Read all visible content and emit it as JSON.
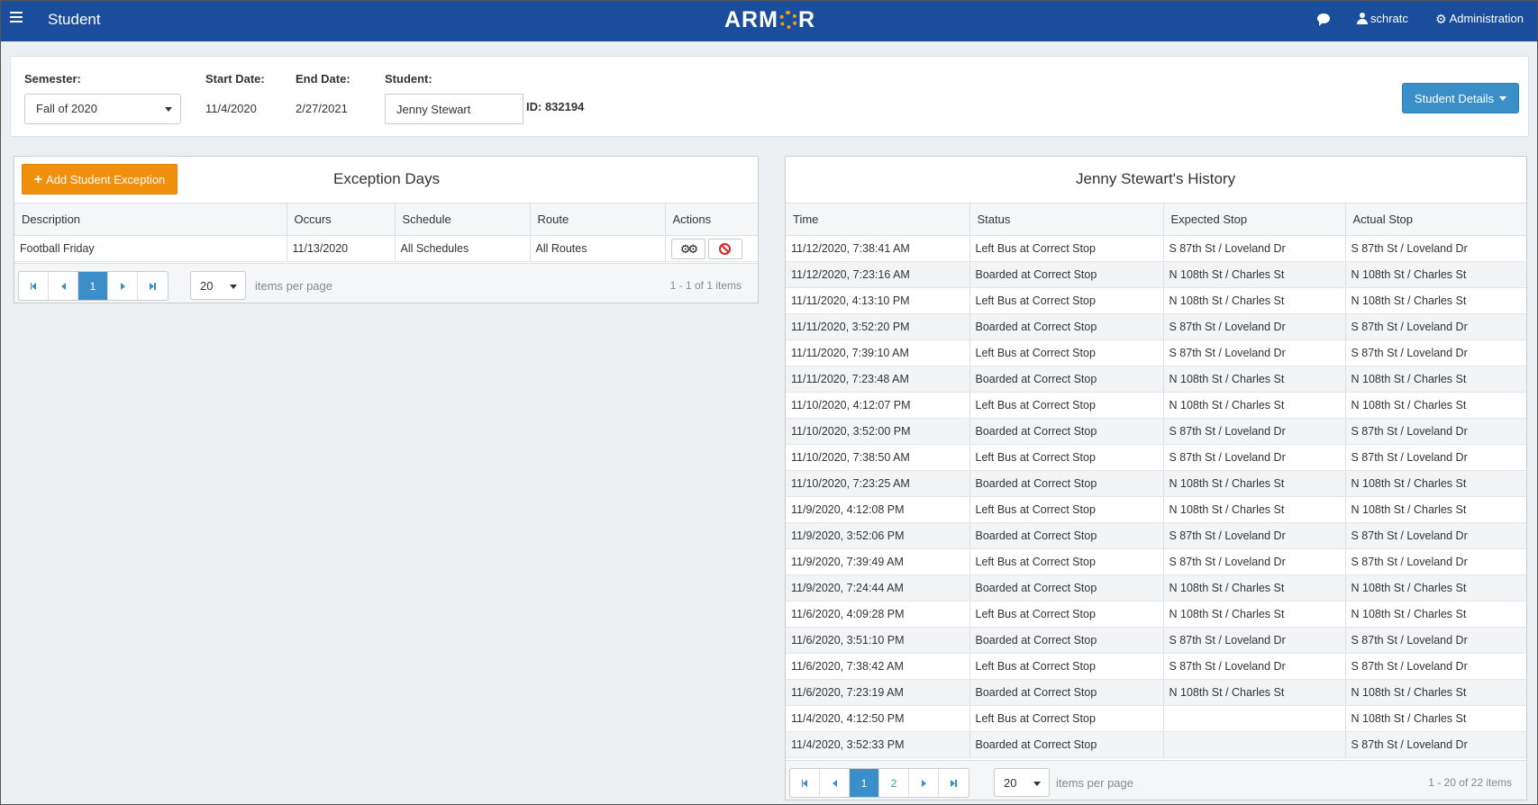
{
  "header": {
    "menu_icon": "hamburger-icon",
    "title": "Student",
    "logo_left": "ARM",
    "logo_right": "R",
    "user": "schratc",
    "admin": "Administration",
    "accent": "#1a4e9c"
  },
  "filters": {
    "semester_label": "Semester:",
    "semester_value": "Fall of 2020",
    "start_label": "Start Date:",
    "start_value": "11/4/2020",
    "end_label": "End Date:",
    "end_value": "2/27/2021",
    "student_label": "Student:",
    "student_value": "Jenny Stewart",
    "id_text": "ID: 832194",
    "details_button": "Student Details"
  },
  "exceptions": {
    "add_button": "Add Student Exception",
    "title": "Exception Days",
    "columns": [
      "Description",
      "Occurs",
      "Schedule",
      "Route",
      "Actions"
    ],
    "rows": [
      {
        "description": "Football Friday",
        "occurs": "11/13/2020",
        "schedule": "All Schedules",
        "route": "All Routes"
      }
    ],
    "page": "1",
    "page_size": "20",
    "per_page_label": "items per page",
    "count": "1 - 1 of 1 items"
  },
  "history": {
    "title": "Jenny Stewart's History",
    "columns": [
      "Time",
      "Status",
      "Expected Stop",
      "Actual Stop"
    ],
    "rows": [
      [
        "11/12/2020, 7:38:41 AM",
        "Left Bus at Correct Stop",
        "S 87th St / Loveland Dr",
        "S 87th St / Loveland Dr"
      ],
      [
        "11/12/2020, 7:23:16 AM",
        "Boarded at Correct Stop",
        "N 108th St / Charles St",
        "N 108th St / Charles St"
      ],
      [
        "11/11/2020, 4:13:10 PM",
        "Left Bus at Correct Stop",
        "N 108th St / Charles St",
        "N 108th St / Charles St"
      ],
      [
        "11/11/2020, 3:52:20 PM",
        "Boarded at Correct Stop",
        "S 87th St / Loveland Dr",
        "S 87th St / Loveland Dr"
      ],
      [
        "11/11/2020, 7:39:10 AM",
        "Left Bus at Correct Stop",
        "S 87th St / Loveland Dr",
        "S 87th St / Loveland Dr"
      ],
      [
        "11/11/2020, 7:23:48 AM",
        "Boarded at Correct Stop",
        "N 108th St / Charles St",
        "N 108th St / Charles St"
      ],
      [
        "11/10/2020, 4:12:07 PM",
        "Left Bus at Correct Stop",
        "N 108th St / Charles St",
        "N 108th St / Charles St"
      ],
      [
        "11/10/2020, 3:52:00 PM",
        "Boarded at Correct Stop",
        "S 87th St / Loveland Dr",
        "S 87th St / Loveland Dr"
      ],
      [
        "11/10/2020, 7:38:50 AM",
        "Left Bus at Correct Stop",
        "S 87th St / Loveland Dr",
        "S 87th St / Loveland Dr"
      ],
      [
        "11/10/2020, 7:23:25 AM",
        "Boarded at Correct Stop",
        "N 108th St / Charles St",
        "N 108th St / Charles St"
      ],
      [
        "11/9/2020, 4:12:08 PM",
        "Left Bus at Correct Stop",
        "N 108th St / Charles St",
        "N 108th St / Charles St"
      ],
      [
        "11/9/2020, 3:52:06 PM",
        "Boarded at Correct Stop",
        "S 87th St / Loveland Dr",
        "S 87th St / Loveland Dr"
      ],
      [
        "11/9/2020, 7:39:49 AM",
        "Left Bus at Correct Stop",
        "S 87th St / Loveland Dr",
        "S 87th St / Loveland Dr"
      ],
      [
        "11/9/2020, 7:24:44 AM",
        "Boarded at Correct Stop",
        "N 108th St / Charles St",
        "N 108th St / Charles St"
      ],
      [
        "11/6/2020, 4:09:28 PM",
        "Left Bus at Correct Stop",
        "N 108th St / Charles St",
        "N 108th St / Charles St"
      ],
      [
        "11/6/2020, 3:51:10 PM",
        "Boarded at Correct Stop",
        "S 87th St / Loveland Dr",
        "S 87th St / Loveland Dr"
      ],
      [
        "11/6/2020, 7:38:42 AM",
        "Left Bus at Correct Stop",
        "S 87th St / Loveland Dr",
        "S 87th St / Loveland Dr"
      ],
      [
        "11/6/2020, 7:23:19 AM",
        "Boarded at Correct Stop",
        "N 108th St / Charles St",
        "N 108th St / Charles St"
      ],
      [
        "11/4/2020, 4:12:50 PM",
        "Left Bus at Correct Stop",
        "",
        "N 108th St / Charles St"
      ],
      [
        "11/4/2020, 3:52:33 PM",
        "Boarded at Correct Stop",
        "",
        "S 87th St / Loveland Dr"
      ]
    ],
    "pages": [
      "1",
      "2"
    ],
    "page_size": "20",
    "per_page_label": "items per page",
    "count": "1 - 20 of 22 items"
  },
  "colors": {
    "primary": "#3b8fc8",
    "add_button": "#f0900c",
    "danger": "#e02020"
  }
}
